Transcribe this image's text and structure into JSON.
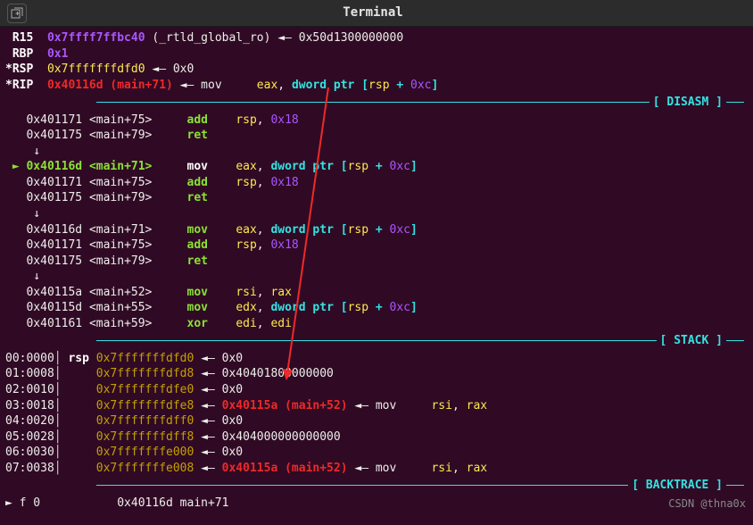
{
  "title": "Terminal",
  "registers": [
    {
      "name": "R15",
      "addr": "0x7ffff7ffbc40",
      "sym": "(_rtld_global_ro)",
      "val": "0x50d1300000000"
    },
    {
      "name": "RBP",
      "addr": "0x1",
      "sym": "",
      "val": ""
    },
    {
      "name": "*RSP",
      "addr": "0x7fffffffdfd0",
      "sym": "",
      "val": "0x0"
    },
    {
      "name": "*RIP",
      "addr": "0x40116d (main+71)",
      "sym": "",
      "inst_mn": "mov",
      "inst_ops": "eax, dword ptr [rsp + 0xc]"
    }
  ],
  "sections": {
    "disasm": "DISASM",
    "stack": "STACK",
    "backtrace": "BACKTRACE"
  },
  "disasm": [
    {
      "cur": false,
      "addr": "0x401171",
      "sym": "<main+75>",
      "mn": "add",
      "ops": "rsp, 0x18"
    },
    {
      "cur": false,
      "addr": "0x401175",
      "sym": "<main+79>",
      "mn": "ret",
      "ops": ""
    },
    {
      "cur": false,
      "arrow": "↓"
    },
    {
      "cur": true,
      "addr": "0x40116d",
      "sym": "<main+71>",
      "mn": "mov",
      "ops": "eax, dword ptr [rsp + 0xc]"
    },
    {
      "cur": false,
      "addr": "0x401171",
      "sym": "<main+75>",
      "mn": "add",
      "ops": "rsp, 0x18"
    },
    {
      "cur": false,
      "addr": "0x401175",
      "sym": "<main+79>",
      "mn": "ret",
      "ops": ""
    },
    {
      "cur": false,
      "arrow": "↓"
    },
    {
      "cur": false,
      "addr": "0x40116d",
      "sym": "<main+71>",
      "mn": "mov",
      "ops": "eax, dword ptr [rsp + 0xc]"
    },
    {
      "cur": false,
      "addr": "0x401171",
      "sym": "<main+75>",
      "mn": "add",
      "ops": "rsp, 0x18"
    },
    {
      "cur": false,
      "addr": "0x401175",
      "sym": "<main+79>",
      "mn": "ret",
      "ops": ""
    },
    {
      "cur": false,
      "arrow": "↓"
    },
    {
      "cur": false,
      "addr": "0x40115a",
      "sym": "<main+52>",
      "mn": "mov",
      "ops": "rsi, rax"
    },
    {
      "cur": false,
      "addr": "0x40115d",
      "sym": "<main+55>",
      "mn": "mov",
      "ops": "edx, dword ptr [rsp + 0xc]"
    },
    {
      "cur": false,
      "addr": "0x401161",
      "sym": "<main+59>",
      "mn": "xor",
      "ops": "edi, edi"
    }
  ],
  "stack": [
    {
      "idx": "00:0000",
      "rsp": true,
      "addr": "0x7fffffffdfd0",
      "chain": "0x0",
      "red": false
    },
    {
      "idx": "01:0008",
      "rsp": false,
      "addr": "0x7fffffffdfd8",
      "chain": "0x40401800000000",
      "red": false
    },
    {
      "idx": "02:0010",
      "rsp": false,
      "addr": "0x7fffffffdfe0",
      "chain": "0x0",
      "red": false
    },
    {
      "idx": "03:0018",
      "rsp": false,
      "addr": "0x7fffffffdfe8",
      "chain": "0x40115a (main+52)",
      "red": true,
      "inst_mn": "mov",
      "inst_ops": "rsi, rax"
    },
    {
      "idx": "04:0020",
      "rsp": false,
      "addr": "0x7fffffffdff0",
      "chain": "0x0",
      "red": false
    },
    {
      "idx": "05:0028",
      "rsp": false,
      "addr": "0x7fffffffdff8",
      "chain": "0x404000000000000",
      "red": false
    },
    {
      "idx": "06:0030",
      "rsp": false,
      "addr": "0x7fffffffe000",
      "chain": "0x0",
      "red": false
    },
    {
      "idx": "07:0038",
      "rsp": false,
      "addr": "0x7fffffffe008",
      "chain": "0x40115a (main+52)",
      "red": true,
      "inst_mn": "mov",
      "inst_ops": "rsi, rax"
    }
  ],
  "backtrace": {
    "line0": "► f 0           0x40116d main+71"
  },
  "arrow_left": "◄—",
  "arrow_plain": "←",
  "watermark": "CSDN @thna0x"
}
